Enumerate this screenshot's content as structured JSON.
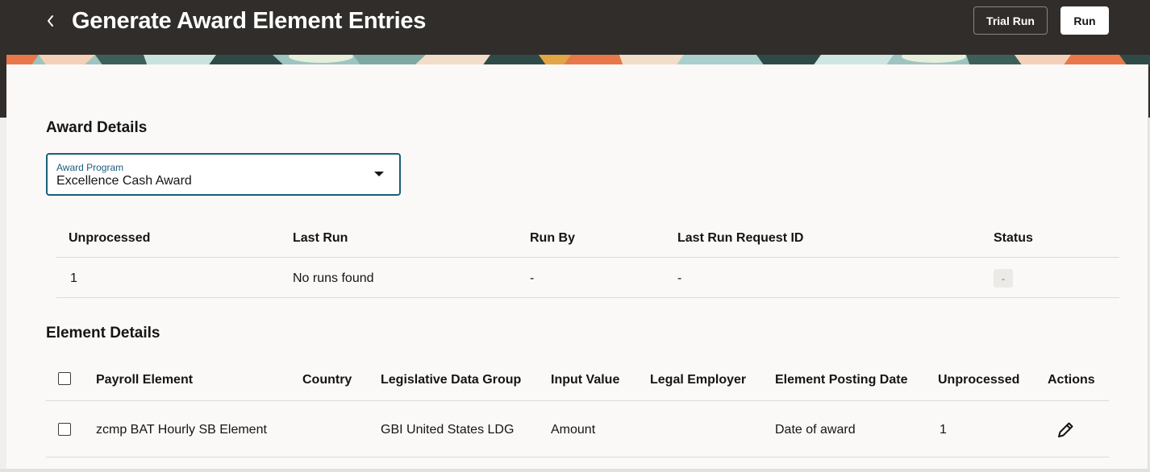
{
  "header": {
    "title": "Generate Award Element Entries",
    "back_icon": "chevron-left-icon",
    "trial_run_label": "Trial Run",
    "run_label": "Run"
  },
  "colors": {
    "header_bg": "#312d2a",
    "focus_accent": "#1b5e7a",
    "card_bg": "#fbf9f8"
  },
  "award_details": {
    "title": "Award Details",
    "award_program": {
      "label": "Award Program",
      "value": "Excellence Cash Award"
    },
    "table": {
      "headers": [
        "Unprocessed",
        "Last Run",
        "Run By",
        "Last Run Request ID",
        "Status"
      ],
      "row": {
        "unprocessed": "1",
        "last_run": "No runs found",
        "run_by": "-",
        "last_run_request_id": "-",
        "status": "-"
      }
    }
  },
  "element_details": {
    "title": "Element Details",
    "headers": [
      "Payroll Element",
      "Country",
      "Legislative Data Group",
      "Input Value",
      "Legal Employer",
      "Element Posting Date",
      "Unprocessed",
      "Actions"
    ],
    "rows": [
      {
        "payroll_element": "zcmp BAT Hourly SB Element",
        "country": "",
        "legislative_data_group": "GBI United States LDG",
        "input_value": "Amount",
        "legal_employer": "",
        "element_posting_date": "Date of award",
        "unprocessed": "1",
        "action_icon": "pencil-icon"
      }
    ]
  }
}
